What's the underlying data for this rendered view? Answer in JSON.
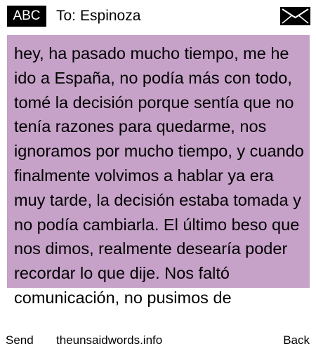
{
  "header": {
    "badge_label": "ABC",
    "to_label": "To:",
    "recipient_name": "Espinoza",
    "envelope_icon": "envelope-icon"
  },
  "message": {
    "text": "hey, ha pasado mucho tiempo, me he ido a España, no podía más con todo, tomé la decisión porque sentía que no tenía razones para quedarme, nos ignoramos por mucho tiempo, y cuando finalmente volvimos a hablar ya era muy tarde, la decisión estaba tomada y no podía cambiarla. El último beso que nos dimos, realmente desearía poder recordar lo que dije. Nos faltó comunicación, no pusimos de",
    "highlight_color": "#c6a1c8"
  },
  "softkeys": {
    "left_label": "Send",
    "center_label": "theunsaidwords.info",
    "right_label": "Back"
  }
}
